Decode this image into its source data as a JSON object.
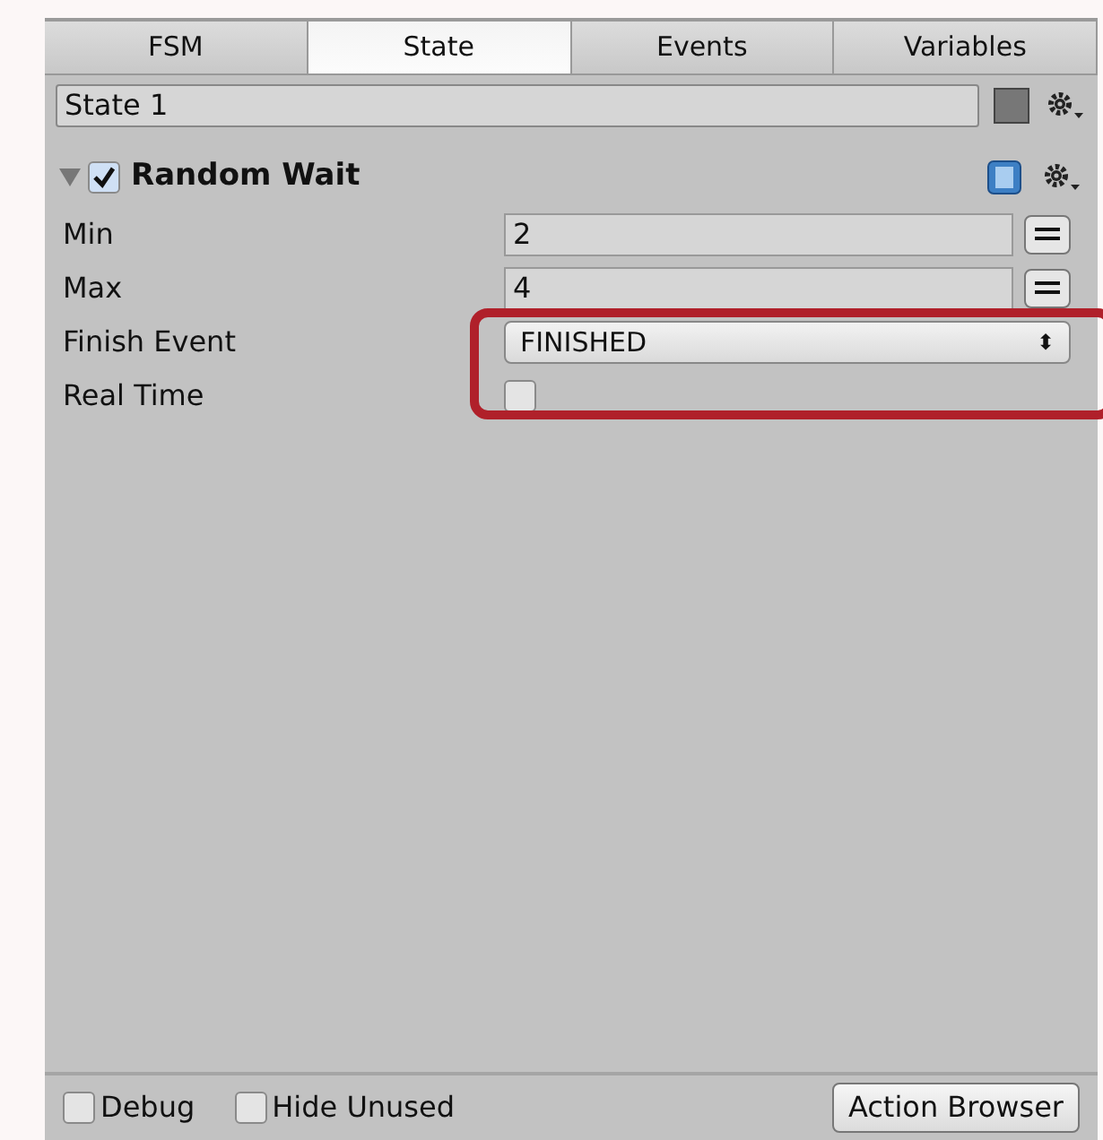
{
  "tabs": [
    {
      "label": "FSM",
      "selected": false
    },
    {
      "label": "State",
      "selected": true
    },
    {
      "label": "Events",
      "selected": false
    },
    {
      "label": "Variables",
      "selected": false
    }
  ],
  "state_name": {
    "value": "State 1"
  },
  "action": {
    "title": "Random Wait",
    "expanded": true,
    "enabled": true,
    "params": [
      {
        "kind": "number",
        "label": "Min",
        "value": "2"
      },
      {
        "kind": "number",
        "label": "Max",
        "value": "4"
      },
      {
        "kind": "dropdown",
        "label": "Finish Event",
        "value": "FINISHED",
        "arrows": "⬍"
      },
      {
        "kind": "checkbox",
        "label": "Real Time",
        "checked": false
      }
    ]
  },
  "footer": {
    "checkboxes": [
      {
        "label": "Debug",
        "checked": false
      },
      {
        "label": "Hide Unused",
        "checked": false
      }
    ],
    "button": "Action Browser"
  }
}
